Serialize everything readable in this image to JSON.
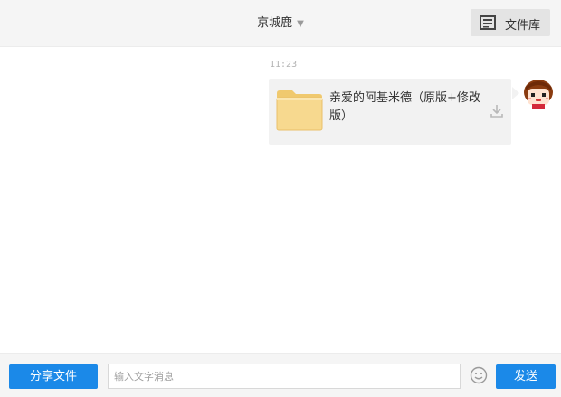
{
  "header": {
    "contact_name": "京城鹿",
    "caret": "▼",
    "library_button_label": "文件库"
  },
  "chat": {
    "messages": [
      {
        "time": "11:23",
        "type": "file",
        "file_name": "亲爱的阿基米德（原版+修改版）"
      }
    ]
  },
  "footer": {
    "share_button_label": "分享文件",
    "input_placeholder": "输入文字消息",
    "input_value": "",
    "send_button_label": "发送"
  },
  "colors": {
    "accent": "#1b89e8",
    "header_bg": "#f5f5f5",
    "bubble_bg": "#f2f2f2",
    "folder": "#f7d98f"
  },
  "icons": {
    "library": "file-library-icon",
    "dropdown": "chevron-down-icon",
    "file": "folder-icon",
    "download": "download-icon",
    "emoji": "smiley-icon",
    "avatar": "avatar"
  }
}
